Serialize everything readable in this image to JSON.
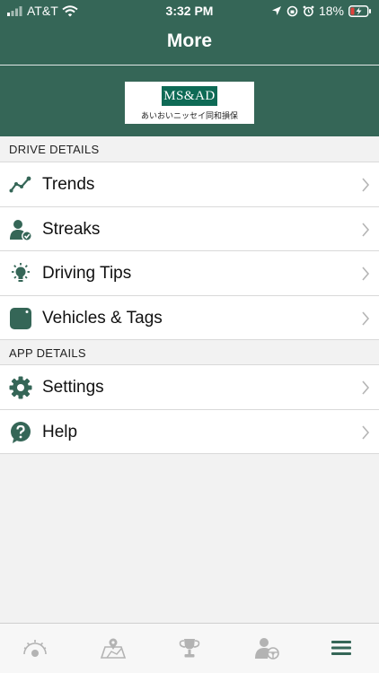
{
  "status": {
    "carrier": "AT&T",
    "time": "3:32 PM",
    "battery": "18%"
  },
  "header": {
    "title": "More",
    "logo_mark": "MS&AD",
    "logo_sub": "あいおいニッセイ同和損保"
  },
  "sections": [
    {
      "title": "DRIVE DETAILS",
      "items": [
        {
          "label": "Trends",
          "icon": "trends-icon"
        },
        {
          "label": "Streaks",
          "icon": "streaks-icon"
        },
        {
          "label": "Driving Tips",
          "icon": "lightbulb-icon"
        },
        {
          "label": "Vehicles & Tags",
          "icon": "vehicle-tag-icon"
        }
      ]
    },
    {
      "title": "APP DETAILS",
      "items": [
        {
          "label": "Settings",
          "icon": "gear-icon"
        },
        {
          "label": "Help",
          "icon": "help-icon"
        }
      ]
    }
  ],
  "tabbar": {
    "tabs": [
      {
        "name": "dashboard-gauge-icon"
      },
      {
        "name": "map-icon"
      },
      {
        "name": "trophy-icon"
      },
      {
        "name": "driver-wheel-icon"
      },
      {
        "name": "menu-icon",
        "active": true
      }
    ]
  },
  "colors": {
    "header_bg": "#356657",
    "icon_green": "#356657",
    "tab_inactive": "#b3b3b3"
  }
}
